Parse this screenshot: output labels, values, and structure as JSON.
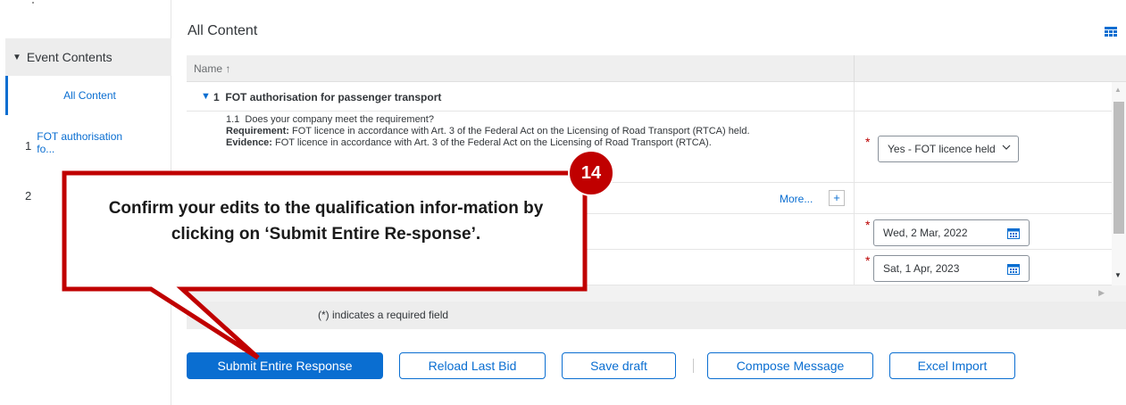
{
  "sidebar": {
    "header": "Event Contents",
    "active_item": "All Content",
    "items": [
      {
        "number": "1",
        "label": "FOT authorisation fo..."
      },
      {
        "number": "2",
        "label": ""
      }
    ]
  },
  "main": {
    "title": "All Content",
    "column_name": "Name ↑",
    "group": {
      "number": "1",
      "title": "FOT authorisation for passenger transport"
    },
    "question": {
      "number": "1.1",
      "text": "Does your company meet the requirement?",
      "requirement_label": "Requirement:",
      "requirement_text": "FOT licence in accordance with Art. 3 of the Federal Act on the Licensing of Road Transport (RTCA) held.",
      "evidence_label": "Evidence:",
      "evidence_text": "FOT licence in accordance with Art. 3 of the Federal Act on the Licensing of Road Transport (RTCA).",
      "answer": "Yes - FOT licence held"
    },
    "more_label": "More...",
    "plus_label": "+",
    "dates": [
      "Wed, 2 Mar, 2022",
      "Sat, 1 Apr, 2023"
    ],
    "required_note": "(*) indicates a required field",
    "required_marker": "*"
  },
  "actions": {
    "submit": "Submit Entire Response",
    "reload": "Reload Last Bid",
    "save_draft": "Save draft",
    "compose": "Compose Message",
    "excel_import": "Excel Import"
  },
  "tutorial": {
    "step": "14",
    "text": "Confirm your edits to the qualification infor-mation by clicking on ‘Submit Entire Re-sponse’."
  },
  "colors": {
    "accent": "#0a6ed1",
    "callout_border": "#c00000",
    "required": "#bb0000"
  }
}
